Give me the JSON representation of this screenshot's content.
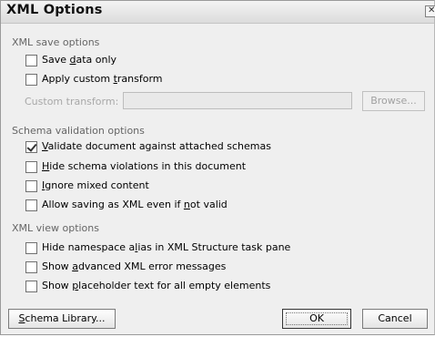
{
  "title": "XML Options",
  "sections": {
    "save": {
      "label": "XML save options"
    },
    "schema": {
      "label": "Schema validation options"
    },
    "view": {
      "label": "XML view options"
    }
  },
  "save_options": {
    "save_data_only": {
      "pre": "Save ",
      "key": "d",
      "post": "ata only",
      "checked": false
    },
    "apply_custom_transform": {
      "pre": "Apply custom ",
      "key": "t",
      "post": "ransform",
      "checked": false
    },
    "custom_transform_label": "Custom transform:",
    "custom_transform_value": "",
    "browse_label": "Browse..."
  },
  "schema_options": {
    "validate": {
      "pre": "",
      "key": "V",
      "post": "alidate document against attached schemas",
      "checked": true
    },
    "hide_violations": {
      "pre": "",
      "key": "H",
      "post": "ide schema violations in this document",
      "checked": false
    },
    "ignore_mixed": {
      "pre": "",
      "key": "I",
      "post": "gnore mixed content",
      "checked": false
    },
    "allow_invalid": {
      "pre": "Allow saving as XML even if ",
      "key": "n",
      "post": "ot valid",
      "checked": false
    }
  },
  "view_options": {
    "hide_namespace": {
      "pre": "Hide namespace a",
      "key": "l",
      "post": "ias in XML Structure task pane",
      "checked": false
    },
    "show_errors": {
      "pre": "Show ",
      "key": "a",
      "post": "dvanced XML error messages",
      "checked": false
    },
    "show_placeholder": {
      "pre": "Show ",
      "key": "p",
      "post": "laceholder text for all empty elements",
      "checked": false
    }
  },
  "buttons": {
    "schema_library": {
      "pre": "",
      "key": "S",
      "post": "chema Library..."
    },
    "ok": "OK",
    "cancel": "Cancel"
  }
}
